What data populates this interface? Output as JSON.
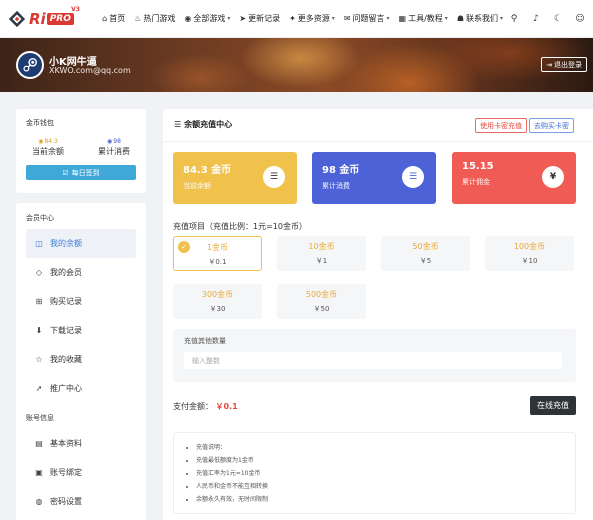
{
  "nav": {
    "logo_text": "Ri",
    "logo_badge": "PRO",
    "logo_version": "V3",
    "items": [
      {
        "label": "首页",
        "icon": "home-icon",
        "glyph": "⌂",
        "caret": false
      },
      {
        "label": "热门游戏",
        "icon": "fire-icon",
        "glyph": "♨",
        "caret": false
      },
      {
        "label": "全部游戏",
        "icon": "gamepad-icon",
        "glyph": "◉",
        "caret": true
      },
      {
        "label": "更新记录",
        "icon": "send-icon",
        "glyph": "➤",
        "caret": false
      },
      {
        "label": "更多资源",
        "icon": "resource-icon",
        "glyph": "✦",
        "caret": true
      },
      {
        "label": "问题留言",
        "icon": "message-icon",
        "glyph": "✉",
        "caret": true
      },
      {
        "label": "工具/教程",
        "icon": "tools-icon",
        "glyph": "▦",
        "caret": true
      },
      {
        "label": "联系我们",
        "icon": "contact-icon",
        "glyph": "☗",
        "caret": true
      }
    ],
    "tool_icons": [
      "search-icon",
      "bell-icon",
      "moon-icon",
      "user-icon"
    ]
  },
  "banner": {
    "username": "小K网牛逼",
    "email": "XKWO.com@qq.com",
    "logout_label": "退出登录"
  },
  "wallet": {
    "title": "金币钱包",
    "balance_value": "84.3",
    "balance_label": "当前余额",
    "spent_value": "98",
    "spent_label": "累计消费",
    "signin_label": "每日签到"
  },
  "sidebar": {
    "member_title": "会员中心",
    "member_items": [
      {
        "label": "我的余额",
        "icon": "wallet-icon",
        "glyph": "◫",
        "active": true
      },
      {
        "label": "我的会员",
        "icon": "diamond-icon",
        "glyph": "◇",
        "active": false
      },
      {
        "label": "购买记录",
        "icon": "cart-icon",
        "glyph": "⊞",
        "active": false
      },
      {
        "label": "下载记录",
        "icon": "download-icon",
        "glyph": "⬇",
        "active": false
      },
      {
        "label": "我的收藏",
        "icon": "star-icon",
        "glyph": "☆",
        "active": false
      },
      {
        "label": "推广中心",
        "icon": "share-icon",
        "glyph": "➚",
        "active": false
      }
    ],
    "account_title": "账号信息",
    "account_items": [
      {
        "label": "基本资料",
        "icon": "id-card-icon",
        "glyph": "▤",
        "active": false
      },
      {
        "label": "账号绑定",
        "icon": "link-icon",
        "glyph": "▣",
        "active": false
      },
      {
        "label": "密码设置",
        "icon": "lock-icon",
        "glyph": "◍",
        "active": false
      }
    ]
  },
  "main": {
    "title": "余额充值中心",
    "card_code_btn": "使用卡密充值",
    "buy_code_btn": "去购买卡密",
    "cards": [
      {
        "value": "84.3 金币",
        "label": "当前余额",
        "icon": "coins-icon",
        "glyph": "☰"
      },
      {
        "value": "98 金币",
        "label": "累计消费",
        "icon": "coins-icon",
        "glyph": "☰"
      },
      {
        "value": "15.15",
        "label": "累计佣金",
        "icon": "yen-icon",
        "glyph": "¥"
      }
    ],
    "rate_label": "充值项目（充值比例：1元=10金币）",
    "options": [
      {
        "coin": "1金币",
        "price": "￥0.1",
        "selected": true
      },
      {
        "coin": "10金币",
        "price": "￥1",
        "selected": false
      },
      {
        "coin": "50金币",
        "price": "￥5",
        "selected": false
      },
      {
        "coin": "100金币",
        "price": "￥10",
        "selected": false
      },
      {
        "coin": "300金币",
        "price": "￥30",
        "selected": false
      },
      {
        "coin": "500金币",
        "price": "￥50",
        "selected": false
      }
    ],
    "other_label": "充值其他数量",
    "other_placeholder": "输入整数",
    "pay_label": "支付金额：",
    "pay_amount": "￥0.1",
    "pay_button": "在线充值",
    "notes": [
      "充值说明：",
      "充值最低额度为1金币",
      "充值汇率为1元=10金币",
      "人民币和金币不能互相转换",
      "余额永久有效，无时间限制"
    ]
  },
  "colors": {
    "accent_red": "#d93a31",
    "gold": "#f0c24b",
    "blue": "#4c62d6",
    "red_card": "#f05b55",
    "signin": "#3fa8d9"
  }
}
